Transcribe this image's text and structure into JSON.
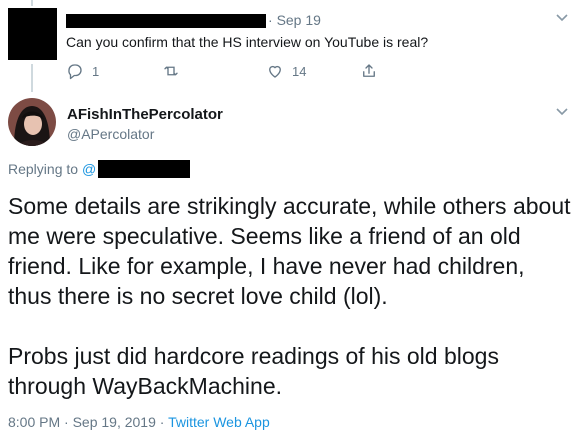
{
  "prev_tweet": {
    "separator": "·",
    "date": "Sep 19",
    "text": "Can you confirm that the HS interview on YouTube is real?",
    "reply_count": "1",
    "like_count": "14"
  },
  "main_tweet": {
    "display_name": "AFishInThePercolator",
    "handle": "@APercolator",
    "replying_to_label": "Replying to",
    "replying_to_at": "@",
    "paragraph1": "Some details are strikingly accurate, while others about me were speculative. Seems like a friend of an old friend. Like for example, I have never had children, thus there is no secret love child (lol).",
    "paragraph2": "Probs just did hardcore readings of his old blogs through WayBackMachine.",
    "timestamp": "8:00 PM · Sep 19, 2019 ·",
    "source": "Twitter Web App"
  },
  "colors": {
    "accent": "#1b95e0",
    "muted": "#657786",
    "text": "#14171a"
  },
  "icons": [
    "reply-icon",
    "retweet-icon",
    "like-icon",
    "share-icon",
    "chevron-down-icon"
  ]
}
